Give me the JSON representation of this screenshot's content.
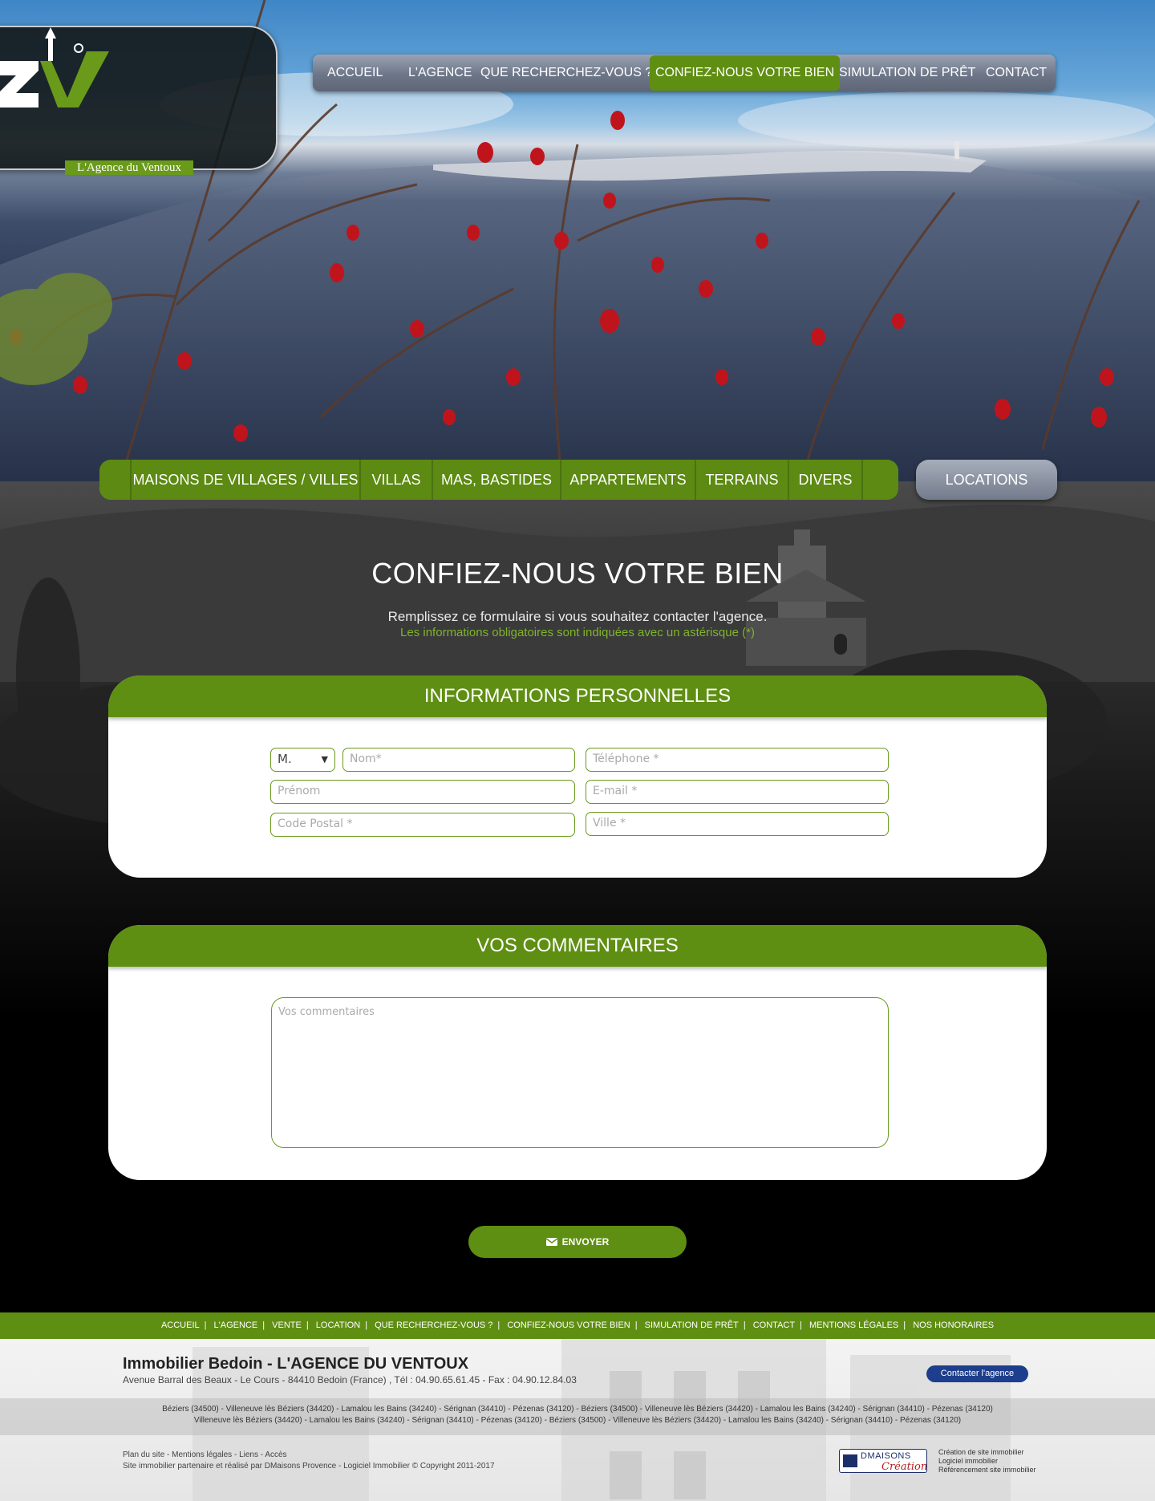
{
  "brand": {
    "logo_text": "ZV",
    "tagline": "L'Agence du Ventoux"
  },
  "topnav": [
    {
      "label": "ACCUEIL"
    },
    {
      "label": "L'AGENCE"
    },
    {
      "label": "QUE RECHERCHEZ-VOUS ?"
    },
    {
      "label": "CONFIEZ-NOUS VOTRE BIEN",
      "active": true
    },
    {
      "label": "SIMULATION DE PRÊT"
    },
    {
      "label": "CONTACT"
    }
  ],
  "categories": [
    {
      "label": "MAISONS DE VILLAGES / VILLES"
    },
    {
      "label": "VILLAS"
    },
    {
      "label": "MAS, BASTIDES"
    },
    {
      "label": "APPARTEMENTS"
    },
    {
      "label": "TERRAINS"
    },
    {
      "label": "DIVERS"
    }
  ],
  "locations_label": "LOCATIONS",
  "page": {
    "title": "CONFIEZ-NOUS VOTRE BIEN",
    "intro": "Remplissez ce formulaire si vous souhaitez contacter l'agence.",
    "required_note": "Les informations obligatoires sont indiquées avec un astérisque (*)"
  },
  "personal": {
    "heading": "INFORMATIONS PERSONNELLES",
    "civility_value": "M.",
    "name_placeholder": "Nom*",
    "phone_placeholder": "Téléphone *",
    "firstname_placeholder": "Prénom",
    "email_placeholder": "E-mail *",
    "postal_placeholder": "Code Postal *",
    "city_placeholder": "Ville *"
  },
  "comments": {
    "heading": "VOS COMMENTAIRES",
    "placeholder": "Vos commentaires"
  },
  "send_label": "ENVOYER",
  "footer_nav": [
    "ACCUEIL",
    "L'AGENCE",
    "VENTE",
    "LOCATION",
    "QUE RECHERCHEZ-VOUS ?",
    "CONFIEZ-NOUS VOTRE BIEN",
    "SIMULATION DE PRÊT",
    "CONTACT",
    "MENTIONS LÉGALES",
    "NOS HONORAIRES"
  ],
  "footer": {
    "agency_name": "Immobilier Bedoin - L'AGENCE DU VENTOUX",
    "address": "Avenue Barral des Beaux - Le Cours - 84410 Bedoin (France) , Tél : 04.90.65.61.45 - Fax : 04.90.12.84.03",
    "contact_button": "Contacter l'agence",
    "cities_line1": "Béziers (34500) - Villeneuve lès Béziers (34420) - Lamalou les Bains (34240) - Sérignan (34410) - Pézenas (34120) - Béziers (34500) - Villeneuve lès Béziers (34420) - Lamalou les Bains (34240) - Sérignan (34410) - Pézenas (34120)",
    "cities_line2": "Villeneuve lès Béziers (34420) - Lamalou les Bains (34240) - Sérignan (34410) - Pézenas (34120) - Béziers (34500) - Villeneuve lès Béziers (34420) - Lamalou les Bains (34240) - Sérignan (34410) - Pézenas (34120)",
    "links_line": "Plan du site - Mentions légales - Liens - Accès",
    "credit_line": "Site immobilier partenaire et réalisé par DMaisons Provence - Logiciel Immobilier © Copyright 2011-2017",
    "dm_logo_text": "DMAISONS",
    "dm_logo_sub": "Création",
    "dm_line1": "Création de site immobilier",
    "dm_line2": "Logiciel immobilier",
    "dm_line3": "Référencement site immobilier"
  },
  "colors": {
    "brand_green": "#5f8f12",
    "nav_gray": "#6d7688",
    "link_green": "#7fb42a",
    "dm_blue": "#1d3e8c"
  }
}
